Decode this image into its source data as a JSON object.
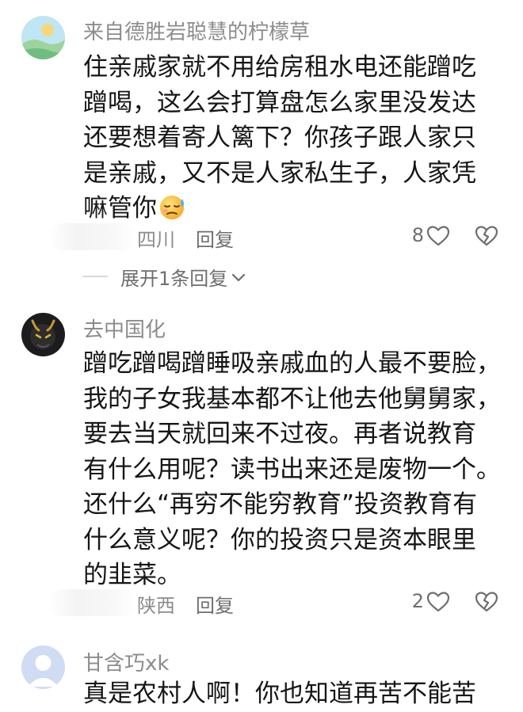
{
  "comments": [
    {
      "username": "来自德胜岩聪慧的柠檬草",
      "content_lines": [
        "住亲戚家就不用给房租水电还能蹭吃",
        "蹭喝，这么会打算盘怎么家里没发达",
        "还要想着寄人篱下？你孩子跟人家只",
        "是亲戚，又不是人家私生子，人家凭",
        "嘛管你"
      ],
      "emoji": "sweat-face-emoji",
      "location": "四川",
      "reply_label": "回复",
      "like_count": "8",
      "expand_label": "展开1条回复"
    },
    {
      "username": "去中国化",
      "content_lines": [
        "蹭吃蹭喝蹭睡吸亲戚血的人最不要脸，",
        "我的子女我基本都不让他去他舅舅家，",
        "要去当天就回来不过夜。再者说教育",
        "有什么用呢？读书出来还是废物一个。",
        "还什么“再穷不能穷教育”投资教育有",
        "什么意义呢？你的投资只是资本眼里",
        "的韭菜。"
      ],
      "location": "陕西",
      "reply_label": "回复",
      "like_count": "2"
    },
    {
      "username": "甘含巧xk",
      "content_lines": [
        "真是农村人啊！你也知道再苦不能苦"
      ]
    }
  ],
  "icons": {
    "like": "heart-outline-icon",
    "dislike": "broken-heart-icon",
    "expand": "chevron-down-icon"
  },
  "colors": {
    "text": "#161616",
    "secondary": "#8c8c8c",
    "meta": "#6e6e6e"
  }
}
